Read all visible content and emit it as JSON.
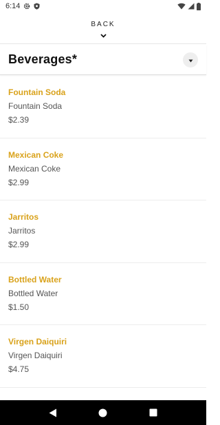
{
  "status_bar": {
    "time": "6:14",
    "icons": [
      "gear-icon",
      "shield-icon",
      "wifi-icon",
      "signal-icon",
      "battery-icon"
    ]
  },
  "header": {
    "back_label": "BACK",
    "back_icon": "chevron-down-icon"
  },
  "category": {
    "title": "Beverages*",
    "toggle_icon": "caret-down-icon"
  },
  "items": [
    {
      "name": "Fountain Soda",
      "description": "Fountain Soda",
      "price": "$2.39"
    },
    {
      "name": "Mexican Coke",
      "description": "Mexican Coke",
      "price": "$2.99"
    },
    {
      "name": "Jarritos",
      "description": "Jarritos",
      "price": "$2.99"
    },
    {
      "name": "Bottled Water",
      "description": "Bottled Water",
      "price": "$1.50"
    },
    {
      "name": "Virgen Daiquiri",
      "description": "Virgen Daiquiri",
      "price": "$4.75"
    }
  ],
  "nav_bar": {
    "buttons": [
      "back-triangle-icon",
      "home-circle-icon",
      "recents-square-icon"
    ]
  },
  "colors": {
    "item_name": "#d9a21b",
    "text_secondary": "#555555",
    "nav_background": "#000000"
  }
}
